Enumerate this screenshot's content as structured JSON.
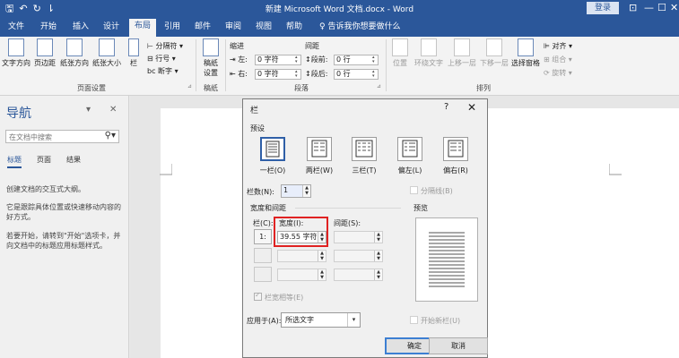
{
  "titlebar": {
    "doc_title": "新建 Microsoft Word 文档.docx - Word",
    "login": "登录",
    "icons": [
      "save-icon",
      "undo-icon",
      "redo-icon",
      "customize-icon"
    ],
    "controls": [
      "ribbon-display-icon",
      "minimize-icon",
      "restore-icon",
      "close-icon"
    ],
    "glyphs": {
      "save": "🖫",
      "undo": "↶",
      "redo": "↻",
      "custom": "⇂",
      "ribbon": "⊡",
      "min": "—",
      "max": "☐",
      "close": "✕"
    }
  },
  "tabs": [
    "文件",
    "开始",
    "插入",
    "设计",
    "布局",
    "引用",
    "邮件",
    "审阅",
    "视图",
    "帮助"
  ],
  "active_tab": "布局",
  "tell_me": "告诉我你想要做什么",
  "ribbon": {
    "page_setup": {
      "buttons": [
        "文字方向",
        "页边距",
        "纸张方向",
        "纸张大小",
        "栏"
      ],
      "small": [
        "分隔符",
        "行号",
        "断字"
      ],
      "group": "页面设置"
    },
    "draft": {
      "line1": "稿纸",
      "line2": "设置",
      "group": "稿纸"
    },
    "paragraph": {
      "indent": "缩进",
      "spacing": "间距",
      "left_label": "左:",
      "left_value": "0 字符",
      "right_label": "右:",
      "right_value": "0 字符",
      "before_label": "段前:",
      "before_value": "0 行",
      "after_label": "段后:",
      "after_value": "0 行",
      "group": "段落"
    },
    "arrange": {
      "buttons": [
        "位置",
        "环绕文字",
        "上移一层",
        "下移一层",
        "选择窗格"
      ],
      "small": [
        "对齐",
        "组合",
        "旋转"
      ],
      "group": "排列"
    }
  },
  "nav": {
    "title": "导航",
    "search_placeholder": "在文档中搜索",
    "tabs": [
      "标题",
      "页面",
      "结果"
    ],
    "text1": "创建文档的交互式大纲。",
    "text2": "它是跟踪具体位置或快速移动内容的好方式。",
    "text3": "若要开始，请转到\"开始\"选项卡，并向文档中的标题应用标题样式。"
  },
  "dialog": {
    "title": "栏",
    "help": "?",
    "presets_label": "预设",
    "presets": [
      "一栏(O)",
      "两栏(W)",
      "三栏(T)",
      "偏左(L)",
      "偏右(R)"
    ],
    "selected_preset": "一栏(O)",
    "num_cols_label": "栏数(N):",
    "num_cols": "1",
    "line_between": "分隔线(B)",
    "width_spacing_label": "宽度和间距",
    "preview_label": "预览",
    "col_header": "栏(C):",
    "width_header": "宽度(I):",
    "spacing_header": "间距(S):",
    "row1_num": "1:",
    "row1_width": "39.55 字符",
    "equal_width": "栏宽相等(E)",
    "apply_label": "应用于(A):",
    "apply_value": "所选文字",
    "start_new_col": "开始新栏(U)",
    "ok": "确定",
    "cancel": "取消"
  },
  "colors": {
    "accent": "#2b579a",
    "highlight": "#e02222"
  }
}
